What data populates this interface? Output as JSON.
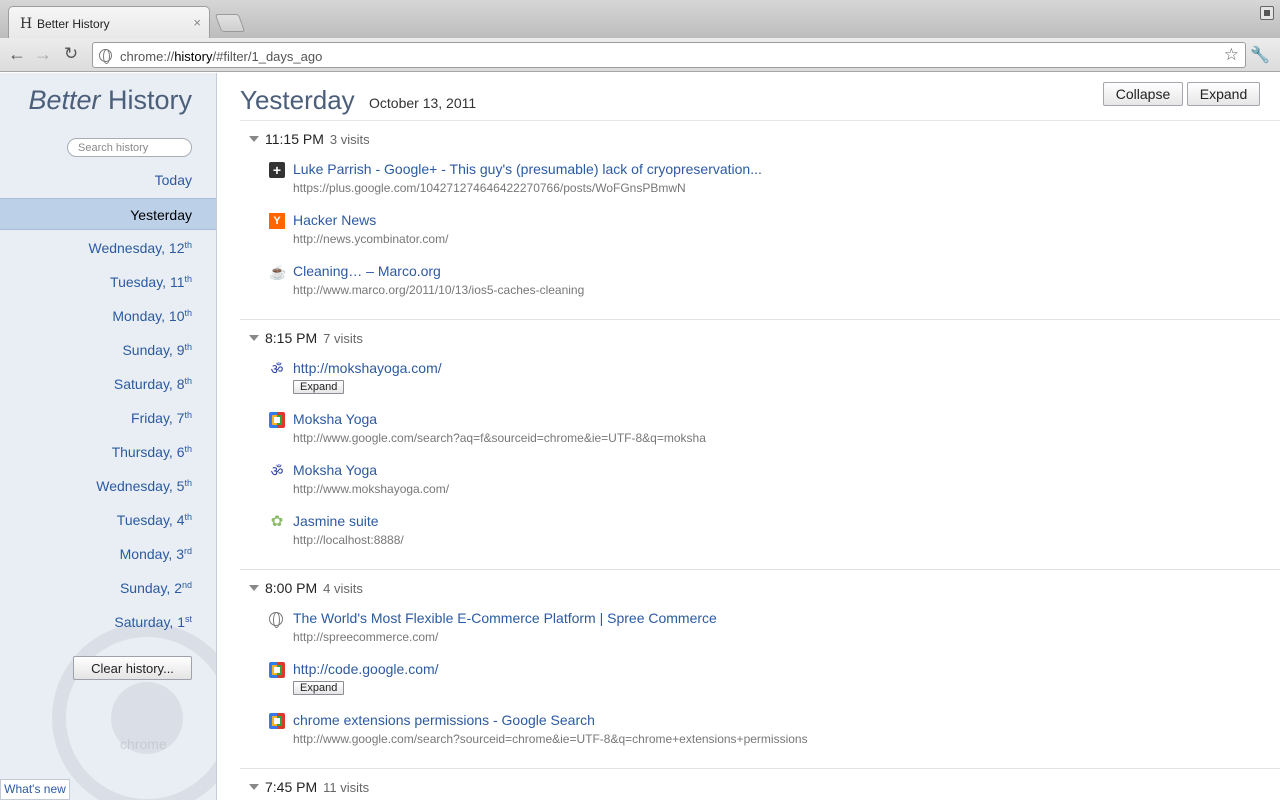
{
  "browser": {
    "tab_favicon": "H",
    "tab_title": "Better History",
    "tab_close": "×",
    "url_prefix": "chrome://",
    "url_host": "history",
    "url_rest": "/#filter/1_days_ago"
  },
  "icons": {
    "back": "←",
    "forward": "→",
    "reload": "↻",
    "star": "☆",
    "wrench": "🔧"
  },
  "sidebar": {
    "logo_italic": "Better",
    "logo_rest": " History",
    "search_placeholder": "Search history",
    "days": [
      {
        "label": "Today",
        "sup": ""
      },
      {
        "label": "Yesterday",
        "sup": ""
      },
      {
        "label": "Wednesday, 12",
        "sup": "th"
      },
      {
        "label": "Tuesday, 11",
        "sup": "th"
      },
      {
        "label": "Monday, 10",
        "sup": "th"
      },
      {
        "label": "Sunday, 9",
        "sup": "th"
      },
      {
        "label": "Saturday, 8",
        "sup": "th"
      },
      {
        "label": "Friday, 7",
        "sup": "th"
      },
      {
        "label": "Thursday, 6",
        "sup": "th"
      },
      {
        "label": "Wednesday, 5",
        "sup": "th"
      },
      {
        "label": "Tuesday, 4",
        "sup": "th"
      },
      {
        "label": "Monday, 3",
        "sup": "rd"
      },
      {
        "label": "Sunday, 2",
        "sup": "nd"
      },
      {
        "label": "Saturday, 1",
        "sup": "st"
      }
    ],
    "active_day": 1,
    "clear_button": "Clear history...",
    "watermark_text": "chrome",
    "whats_new": "What's new"
  },
  "main": {
    "title": "Yesterday",
    "date": "October 13, 2011",
    "collapse_button": "Collapse",
    "expand_button": "Expand",
    "groups": [
      {
        "time": "11:15 PM",
        "count": "3 visits",
        "visits": [
          {
            "icon": "gplus",
            "glyph": "+",
            "title": "Luke Parrish - Google+ - This guy's (presumable) lack of cryopreservation...",
            "url": "https://plus.google.com/104271274646422270766/posts/WoFGnsPBmwN"
          },
          {
            "icon": "hn",
            "glyph": "Y",
            "title": "Hacker News",
            "url": "http://news.ycombinator.com/"
          },
          {
            "icon": "marco",
            "glyph": "☕",
            "title": "Cleaning… – Marco.org",
            "url": "http://www.marco.org/2011/10/13/ios5-caches-cleaning"
          }
        ]
      },
      {
        "time": "8:15 PM",
        "count": "7 visits",
        "visits": [
          {
            "icon": "om",
            "glyph": "ॐ",
            "title": "http://mokshayoga.com/",
            "expand": "Expand"
          },
          {
            "icon": "google",
            "glyph": "",
            "title": "Moksha Yoga",
            "url": "http://www.google.com/search?aq=f&sourceid=chrome&ie=UTF-8&q=moksha"
          },
          {
            "icon": "om",
            "glyph": "ॐ",
            "title": "Moksha Yoga",
            "url": "http://www.mokshayoga.com/"
          },
          {
            "icon": "jasmine",
            "glyph": "✿",
            "title": "Jasmine suite",
            "url": "http://localhost:8888/"
          }
        ]
      },
      {
        "time": "8:00 PM",
        "count": "4 visits",
        "visits": [
          {
            "icon": "spree",
            "glyph": "",
            "title": "The World's Most Flexible E-Commerce Platform | Spree Commerce",
            "url": "http://spreecommerce.com/"
          },
          {
            "icon": "google",
            "glyph": "",
            "title": "http://code.google.com/",
            "expand": "Expand"
          },
          {
            "icon": "google",
            "glyph": "",
            "title": "chrome extensions permissions - Google Search",
            "url": "http://www.google.com/search?sourceid=chrome&ie=UTF-8&q=chrome+extensions+permissions"
          }
        ]
      },
      {
        "time": "7:45 PM",
        "count": "11 visits",
        "visits": []
      }
    ]
  }
}
